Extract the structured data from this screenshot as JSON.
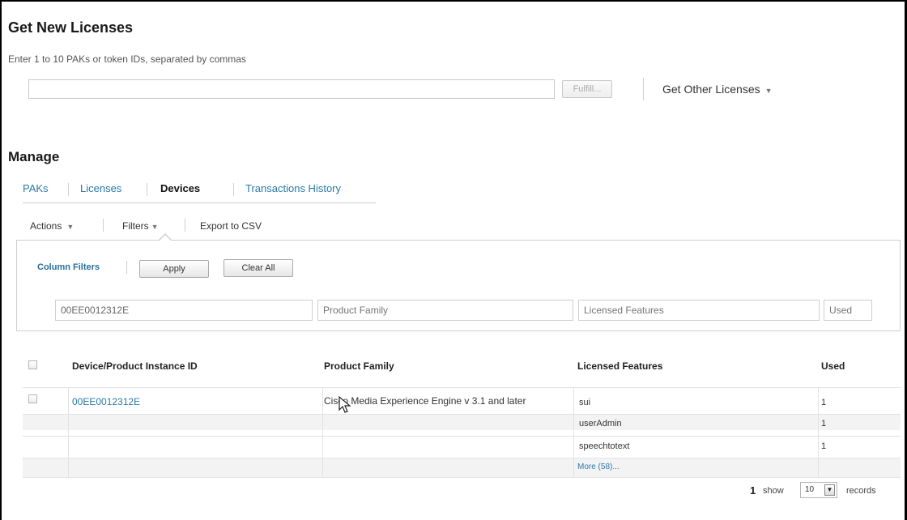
{
  "get_licenses": {
    "title": "Get New Licenses",
    "hint": "Enter 1 to 10 PAKs or token IDs, separated by commas",
    "input_value": "",
    "fulfill_label": "Fulfill...",
    "other_licenses_label": "Get Other Licenses",
    "other_licenses_caret": "▼"
  },
  "manage": {
    "title": "Manage",
    "tabs": [
      {
        "label": "PAKs",
        "active": false
      },
      {
        "label": "Licenses",
        "active": false
      },
      {
        "label": "Devices",
        "active": true
      },
      {
        "label": "Transactions History",
        "active": false
      }
    ]
  },
  "toolbar": {
    "actions_label": "Actions",
    "actions_caret": "▼",
    "filters_label": "Filters",
    "filters_caret": "▼",
    "export_label": "Export to CSV"
  },
  "filters": {
    "label": "Column Filters",
    "apply_label": "Apply",
    "clear_label": "Clear All",
    "device_id_value": "00EE0012312E",
    "product_family_placeholder": "Product Family",
    "licensed_features_placeholder": "Licensed Features",
    "used_placeholder": "Used"
  },
  "table": {
    "headers": {
      "device": "Device/Product Instance ID",
      "family": "Product Family",
      "features": "Licensed Features",
      "used": "Used"
    },
    "device_id": "00EE0012312E",
    "product_family": "Cisco Media Experience Engine v 3.1 and later",
    "feature_rows": [
      {
        "feature": "sui",
        "used": "1"
      },
      {
        "feature": "userAdmin",
        "used": "1"
      },
      {
        "feature": "speechtotext",
        "used": "1"
      }
    ],
    "more_label": "More (58)..."
  },
  "pager": {
    "page": "1",
    "show_label": "show",
    "page_size": "10",
    "records_label": "records"
  },
  "colors": {
    "link": "#2a7aa8",
    "row_band": "#f3f3f3"
  }
}
